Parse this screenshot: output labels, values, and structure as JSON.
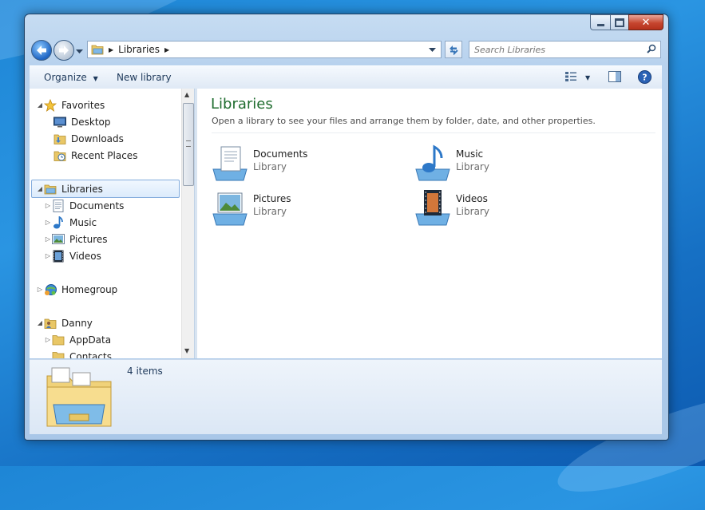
{
  "window": {
    "address": {
      "crumb": "Libraries"
    },
    "search": {
      "placeholder": "Search Libraries"
    }
  },
  "toolbar": {
    "organize_label": "Organize",
    "new_library_label": "New library"
  },
  "nav": {
    "favorites": {
      "label": "Favorites",
      "items": [
        {
          "label": "Desktop",
          "icon": "desktop-icon"
        },
        {
          "label": "Downloads",
          "icon": "downloads-folder-icon"
        },
        {
          "label": "Recent Places",
          "icon": "recent-places-icon"
        }
      ]
    },
    "libraries": {
      "label": "Libraries",
      "items": [
        {
          "label": "Documents",
          "icon": "documents-icon"
        },
        {
          "label": "Music",
          "icon": "music-icon"
        },
        {
          "label": "Pictures",
          "icon": "pictures-icon"
        },
        {
          "label": "Videos",
          "icon": "videos-icon"
        }
      ]
    },
    "homegroup": {
      "label": "Homegroup"
    },
    "user": {
      "label": "Danny",
      "items": [
        {
          "label": "AppData"
        },
        {
          "label": "Contacts"
        }
      ]
    }
  },
  "main": {
    "title": "Libraries",
    "subtitle": "Open a library to see your files and arrange them by folder, date, and other properties.",
    "libraries": [
      {
        "name": "Documents",
        "type": "Library",
        "icon": "documents-library-icon"
      },
      {
        "name": "Music",
        "type": "Library",
        "icon": "music-library-icon"
      },
      {
        "name": "Pictures",
        "type": "Library",
        "icon": "pictures-library-icon"
      },
      {
        "name": "Videos",
        "type": "Library",
        "icon": "videos-library-icon"
      }
    ]
  },
  "details": {
    "count": "4 items"
  },
  "colors": {
    "accent_title": "#1e6c2e",
    "selection_border": "#84acdd",
    "close_button": "#c6462f"
  }
}
